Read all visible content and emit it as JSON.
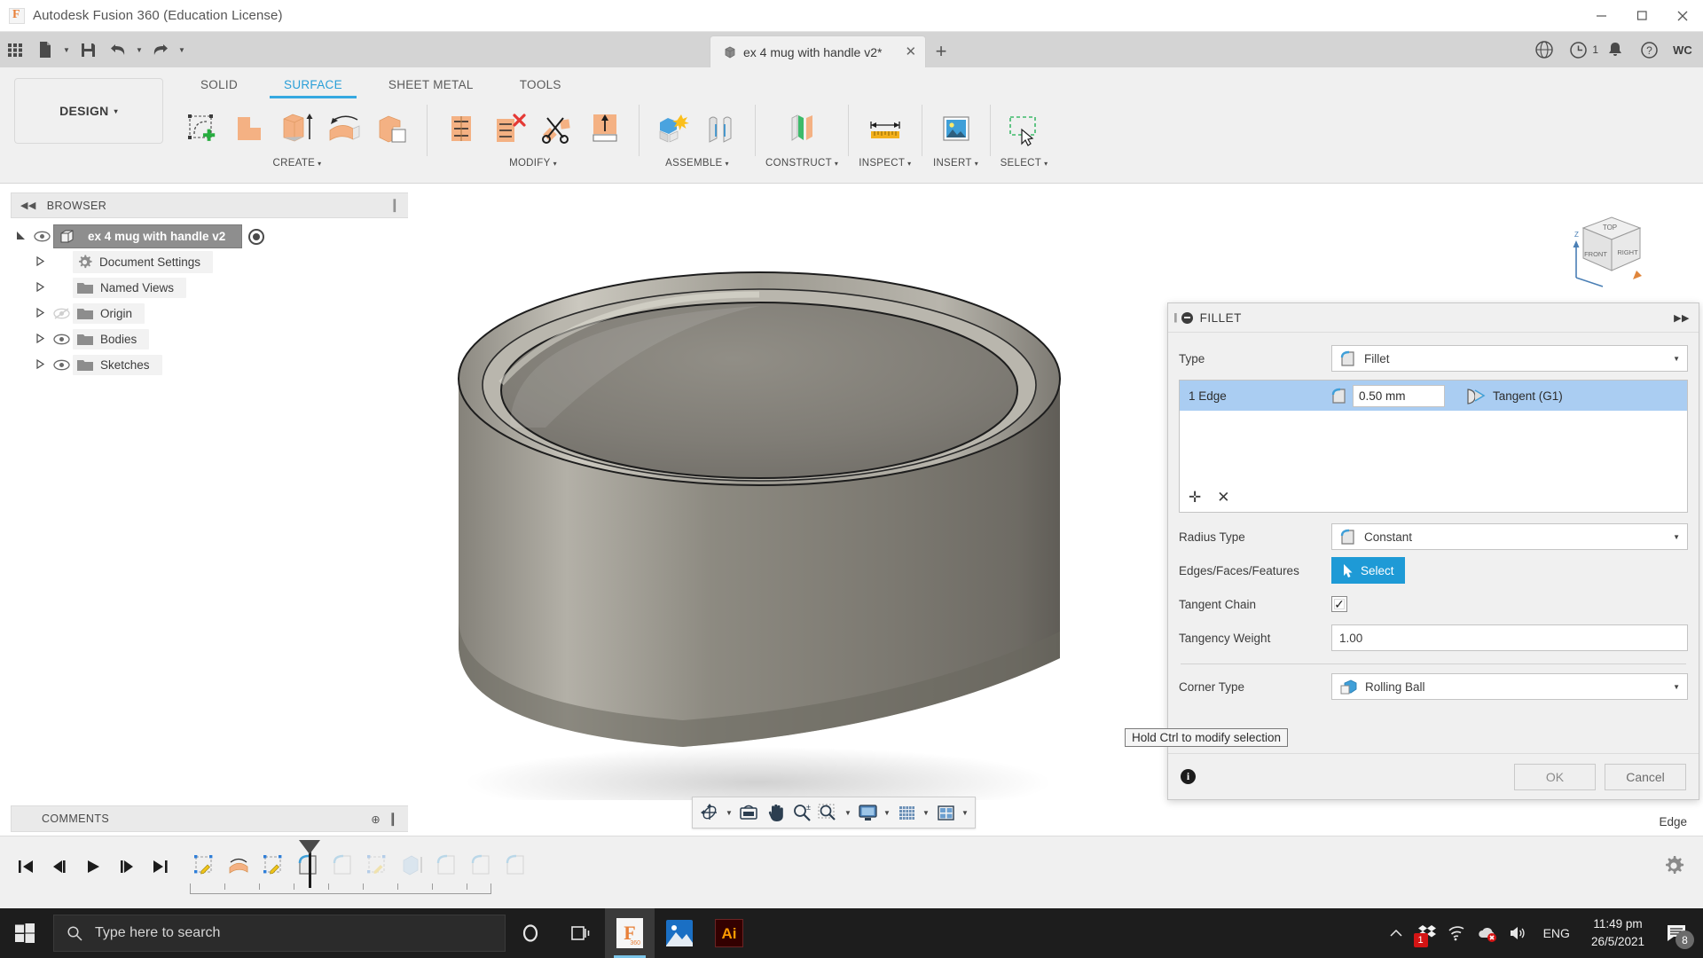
{
  "titlebar": {
    "app_title": "Autodesk Fusion 360 (Education License)",
    "logo_icon": "fusion-360-logo-icon",
    "minimize_icon": "minimize-icon",
    "maximize_icon": "maximize-icon",
    "close_icon": "close-icon"
  },
  "quick_access": {
    "grid_icon": "app-grid-icon",
    "new_icon": "new-document-icon",
    "save_icon": "save-icon",
    "undo_icon": "undo-icon",
    "redo_icon": "redo-icon",
    "document_tab": {
      "label": "ex 4 mug with handle v2*",
      "cube_icon": "component-cube-icon",
      "close_icon": "tab-close-icon"
    },
    "new_tab_icon": "new-tab-plus-icon",
    "extensions_icon": "extensions-icon",
    "job_status_icon": "job-status-clock-icon",
    "job_status_count": "1",
    "notifications_icon": "bell-icon",
    "help_icon": "help-question-icon",
    "account_initials": "WC"
  },
  "ribbon": {
    "workspace_label": "DESIGN",
    "workspace_caret": "▾",
    "tabs": [
      {
        "label": "SOLID",
        "active": false
      },
      {
        "label": "SURFACE",
        "active": true
      },
      {
        "label": "SHEET METAL",
        "active": false
      },
      {
        "label": "TOOLS",
        "active": false
      }
    ],
    "panels": [
      {
        "label": "CREATE",
        "caret": "▾",
        "icons": [
          "create-sketch-icon",
          "patch-icon",
          "extrude-icon",
          "revolve-icon",
          "offset-icon"
        ]
      },
      {
        "label": "MODIFY",
        "caret": "▾",
        "icons": [
          "stitch-icon",
          "unstitch-icon",
          "trim-icon",
          "extend-icon"
        ]
      },
      {
        "label": "ASSEMBLE",
        "caret": "▾",
        "icons": [
          "new-component-icon",
          "joint-icon"
        ]
      },
      {
        "label": "CONSTRUCT",
        "caret": "▾",
        "icons": [
          "offset-plane-icon"
        ]
      },
      {
        "label": "INSPECT",
        "caret": "▾",
        "icons": [
          "measure-icon"
        ]
      },
      {
        "label": "INSERT",
        "caret": "▾",
        "icons": [
          "insert-image-icon"
        ]
      },
      {
        "label": "SELECT",
        "caret": "▾",
        "icons": [
          "select-window-icon"
        ]
      }
    ]
  },
  "browser": {
    "header": "BROWSER",
    "collapse_icon": "collapse-left-icon",
    "grip_icon": "panel-grip-icon",
    "root": {
      "label": "ex 4 mug with handle v2",
      "expand_icon": "expanded-triangle-icon",
      "eye_icon": "eye-visible-icon",
      "cube_icon": "component-cube-icon",
      "activate_icon": "activate-radio-icon"
    },
    "items": [
      {
        "label": "Document Settings",
        "icon": "gear-icon",
        "eye": false,
        "expand_icon": "collapsed-triangle-icon"
      },
      {
        "label": "Named Views",
        "icon": "folder-icon",
        "eye": false,
        "expand_icon": "collapsed-triangle-icon"
      },
      {
        "label": "Origin",
        "icon": "folder-icon",
        "eye": true,
        "eye_hidden": true,
        "expand_icon": "collapsed-triangle-icon"
      },
      {
        "label": "Bodies",
        "icon": "folder-icon",
        "eye": true,
        "eye_hidden": false,
        "expand_icon": "collapsed-triangle-icon"
      },
      {
        "label": "Sketches",
        "icon": "folder-icon",
        "eye": true,
        "eye_hidden": false,
        "expand_icon": "collapsed-triangle-icon"
      }
    ]
  },
  "comments": {
    "label": "COMMENTS",
    "add_icon": "add-comment-icon",
    "grip_icon": "panel-grip-icon"
  },
  "viewport": {
    "viewcube_labels": {
      "top": "TOP",
      "front": "FRONT",
      "right": "RIGHT",
      "z_axis": "Z"
    },
    "cursor_icon": "selection-arrow-cursor-icon",
    "status_text": "Edge",
    "navbar": {
      "orbit_icon": "orbit-icon",
      "look_at_icon": "look-at-icon",
      "pan_icon": "pan-hand-icon",
      "zoom_icon": "zoom-icon",
      "fit_icon": "zoom-fit-icon",
      "display_icon": "display-settings-icon",
      "grid_icon": "grid-snap-icon",
      "viewports_icon": "viewports-icon",
      "caret": "▾"
    }
  },
  "fillet_dialog": {
    "title": "FILLET",
    "minimize_icon": "dialog-minimize-icon",
    "grip_icon": "dialog-grip-icon",
    "expand_icon": "dialog-expand-icon",
    "type_label": "Type",
    "type_value": "Fillet",
    "type_icon": "fillet-icon",
    "edge_row": {
      "label": "1 Edge",
      "radius_value": "0.50 mm",
      "radius_icon": "fillet-icon",
      "continuity": "Tangent (G1)",
      "continuity_icon": "tangent-g1-icon"
    },
    "list_add_icon": "add-selection-icon",
    "list_remove_icon": "remove-selection-icon",
    "radius_type_label": "Radius Type",
    "radius_type_value": "Constant",
    "radius_type_icon": "constant-radius-icon",
    "selection_label": "Edges/Faces/Features",
    "select_button": "Select",
    "select_icon": "select-cursor-icon",
    "tangent_chain_label": "Tangent Chain",
    "tangent_chain_checked": "✓",
    "tangency_weight_label": "Tangency Weight",
    "tangency_weight_value": "1.00",
    "corner_type_label": "Corner Type",
    "corner_type_value": "Rolling Ball",
    "corner_type_icon": "rolling-ball-icon",
    "info_icon": "info-icon",
    "ok_button": "OK",
    "cancel_button": "Cancel",
    "inline_edit_value": "0.50 mm",
    "inline_edit_handle_icon": "drag-handle-icon",
    "inline_edit_menu_icon": "more-options-icon"
  },
  "tooltip": {
    "text": "Hold Ctrl to modify selection"
  },
  "timeline": {
    "playback": [
      "go-to-beginning-icon",
      "step-back-icon",
      "play-icon",
      "step-forward-icon",
      "go-to-end-icon"
    ],
    "features": [
      "sketch-feature-icon",
      "revolve-feature-icon",
      "sketch-feature-icon",
      "fillet-feature-icon",
      "fillet-feature-ghost-icon",
      "sketch-feature-ghost-icon",
      "extrude-feature-ghost-icon",
      "fillet-feature-ghost-icon",
      "fillet-feature-ghost-icon",
      "fillet-feature-ghost-icon"
    ],
    "marker_icon": "timeline-marker-icon",
    "settings_icon": "timeline-settings-gear-icon"
  },
  "taskbar": {
    "start_icon": "windows-start-icon",
    "search_placeholder": "Type here to search",
    "search_icon": "search-magnifier-icon",
    "cortana_icon": "cortana-circle-icon",
    "taskview_icon": "task-view-icon",
    "apps": [
      {
        "icon": "fusion-360-taskbar-icon",
        "label": "360",
        "active": true
      },
      {
        "icon": "photos-taskbar-icon",
        "active": false
      },
      {
        "icon": "illustrator-taskbar-icon",
        "label": "Ai",
        "active": false
      }
    ],
    "tray": {
      "chevron_icon": "show-hidden-icons-chevron",
      "dropbox_icon": "dropbox-icon",
      "dropbox_badge": "1",
      "wifi_icon": "wifi-icon",
      "onedrive_icon": "onedrive-error-icon",
      "volume_icon": "volume-icon",
      "language": "ENG"
    },
    "clock": {
      "time": "11:49 pm",
      "date": "26/5/2021"
    },
    "action_center_icon": "action-center-icon",
    "action_center_count": "8",
    "scroll_up_icon": "scroll-up-icon",
    "scroll_down_icon": "scroll-down-icon"
  },
  "colors": {
    "accent_blue": "#36a9e1",
    "select_button_blue": "#1e9ad6",
    "selection_row_blue": "#aacdf2",
    "ribbon_bg": "#f0f0f0",
    "qat_bg": "#d4d4d4",
    "taskbar_bg": "#1d1d1d",
    "model_grey": "#7d7a72"
  }
}
